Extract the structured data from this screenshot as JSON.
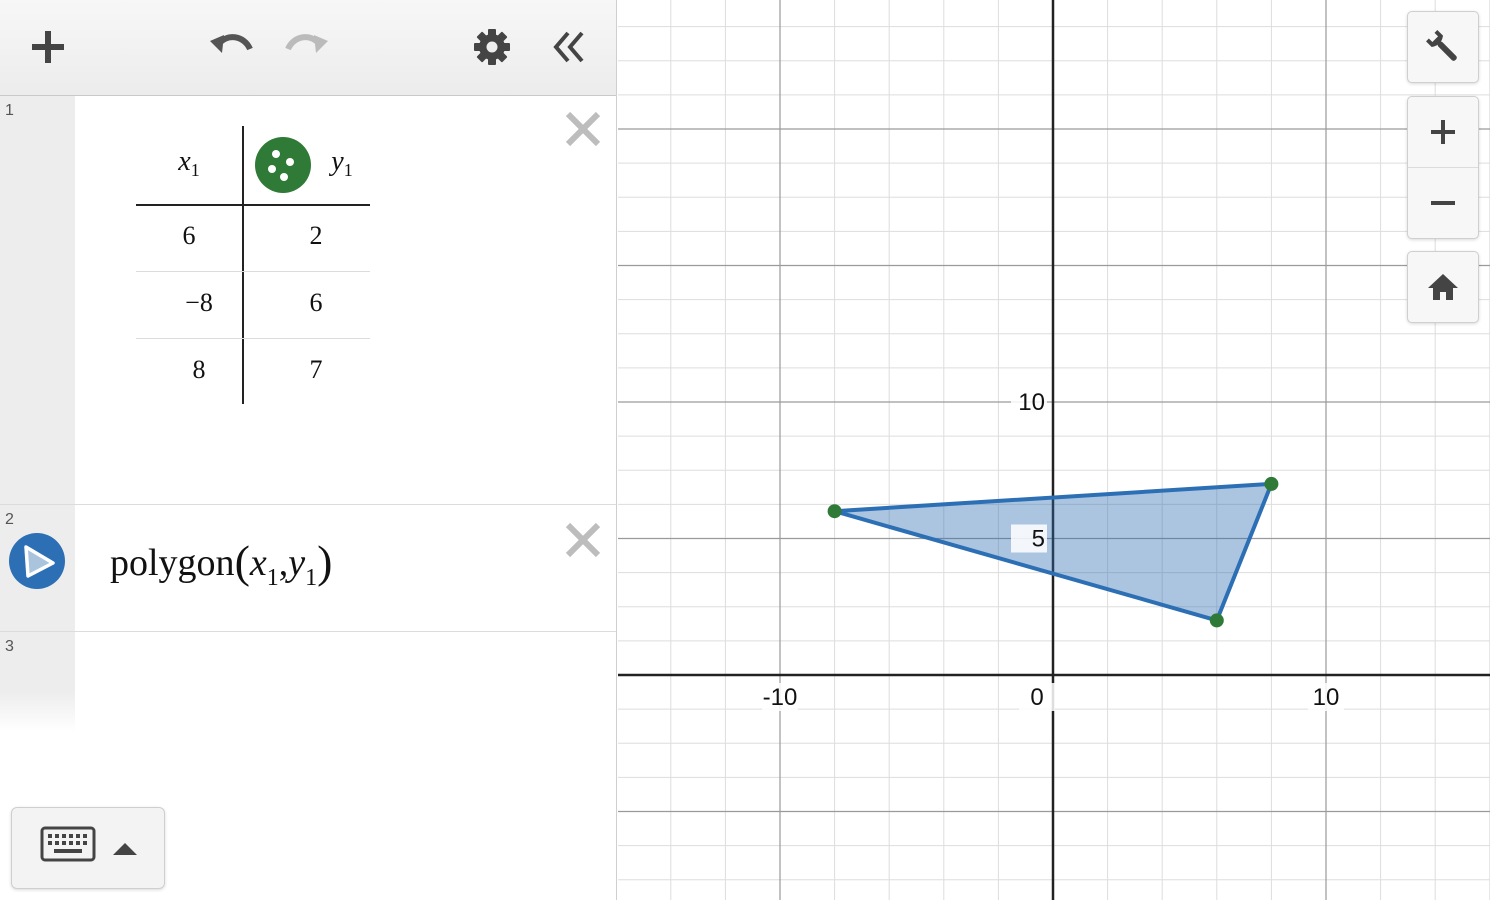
{
  "toolbar": {
    "add": "add-icon",
    "undo": "undo-icon",
    "redo": "redo-icon",
    "settings": "gear-icon",
    "collapse": "double-chevron-left-icon"
  },
  "expressions": [
    {
      "num": "1",
      "type": "table",
      "headers": [
        {
          "var": "x",
          "sub": "1"
        },
        {
          "var": "y",
          "sub": "1"
        }
      ],
      "rows": [
        [
          "6",
          "2"
        ],
        [
          "−8",
          "6"
        ],
        [
          "8",
          "7"
        ]
      ],
      "point_color": "#2f7a36"
    },
    {
      "num": "2",
      "type": "expression",
      "fn": "polygon",
      "args": [
        {
          "var": "x",
          "sub": "1"
        },
        {
          "var": "y",
          "sub": "1"
        }
      ],
      "icon_color": "#2d6fb4"
    },
    {
      "num": "3",
      "type": "empty"
    }
  ],
  "keyboard_button": {
    "icon": "keyboard-icon",
    "arrow": "caret-up-icon"
  },
  "graph_controls": [
    "wrench-icon",
    "zoom-in-icon",
    "zoom-out-icon",
    "home-icon"
  ],
  "graph": {
    "x_ticks": [
      "-10",
      "0",
      "10"
    ],
    "y_ticks": [
      "5",
      "10"
    ],
    "polygon_color": "#2d6fb4",
    "point_color": "#2f7a36",
    "vertices": [
      [
        6,
        2
      ],
      [
        -8,
        6
      ],
      [
        8,
        7
      ]
    ]
  }
}
